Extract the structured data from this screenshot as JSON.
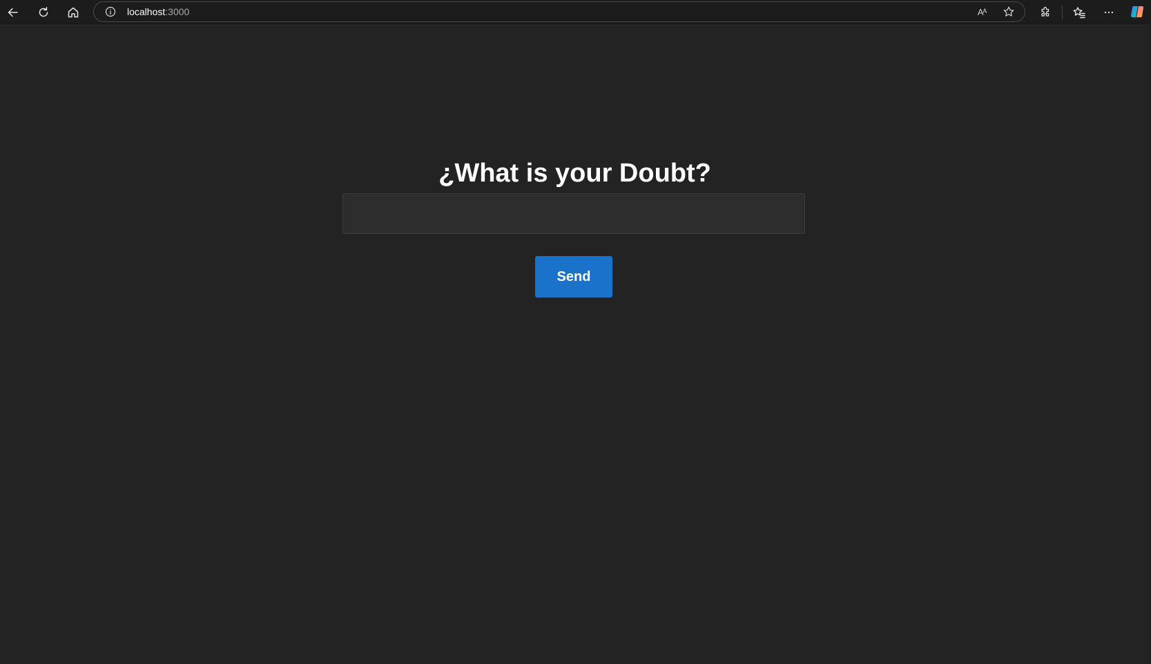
{
  "browser": {
    "url_host": "localhost",
    "url_port": ":3000",
    "read_aloud_label": "Aᴬ",
    "icons": {
      "back": "back-arrow-icon",
      "refresh": "refresh-icon",
      "home": "home-icon",
      "site_info": "info-icon",
      "read_aloud": "read-aloud-icon",
      "favorite": "star-icon",
      "extensions": "puzzle-icon",
      "favorites": "favorites-list-icon",
      "more": "more-dots-icon",
      "copilot": "copilot-icon"
    }
  },
  "main": {
    "heading": "¿What is your Doubt?",
    "input_value": "",
    "send_label": "Send"
  },
  "colors": {
    "page_background": "#232323",
    "accent_button": "#1a73c9",
    "input_background": "#2d2d2d"
  }
}
